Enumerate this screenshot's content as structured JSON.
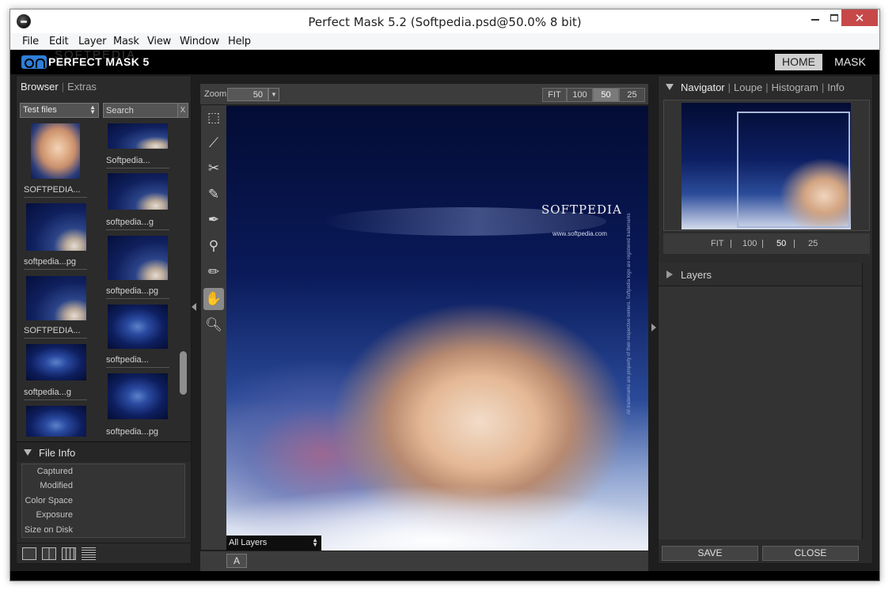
{
  "window": {
    "title": "Perfect Mask 5.2 (Softpedia.psd@50.0% 8 bit)"
  },
  "menu": {
    "items": [
      "File",
      "Edit",
      "Layer",
      "Mask",
      "View",
      "Window",
      "Help"
    ]
  },
  "brand": {
    "name": "PERFECT MASK 5",
    "watermark": "SOFTPEDIA",
    "home": "HOME",
    "mask": "MASK"
  },
  "left": {
    "tabs": {
      "browser": "Browser",
      "extras": "Extras"
    },
    "folder": "Test files",
    "search_placeholder": "Search",
    "search_clear": "X",
    "thumbnails": [
      {
        "caption": "SOFTPEDIA...",
        "style": "face"
      },
      {
        "caption": "Softpedia...",
        "style": "blue"
      },
      {
        "caption": "softpedia...g",
        "style": "blue"
      },
      {
        "caption": "softpedia...pg",
        "style": "blue"
      },
      {
        "caption": "softpedia...pg",
        "style": "blue"
      },
      {
        "caption": "SOFTPEDIA...",
        "style": "blue"
      },
      {
        "caption": "softpedia...",
        "style": "swirl"
      },
      {
        "caption": "softpedia...g",
        "style": "swirl"
      },
      {
        "caption": "softpedia...pg",
        "style": "swirl"
      },
      {
        "caption": "",
        "style": "swirl"
      }
    ],
    "file_info": {
      "title": "File Info",
      "rows": [
        "Captured",
        "Modified",
        "Color Space",
        "Exposure",
        "Size on Disk"
      ]
    }
  },
  "center": {
    "zoom_label": "Zoom",
    "zoom_value": "50",
    "zoom_buttons": [
      "FIT",
      "100",
      "50",
      "25"
    ],
    "zoom_active": "50",
    "layers_select": "All Layers",
    "a_button": "A",
    "canvas": {
      "logo_text": "SOFTPEDIA",
      "url_text": "www.softpedia.com",
      "side_text": "All trademarks are property of their respective owners. Softpedia logo are registered trademarks"
    }
  },
  "right": {
    "tabs": [
      "Navigator",
      "Loupe",
      "Histogram",
      "Info"
    ],
    "active_tab": "Navigator",
    "nav_zoom": [
      "FIT",
      "100",
      "50",
      "25"
    ],
    "nav_zoom_active": "50",
    "layers_title": "Layers",
    "save": "SAVE",
    "close": "CLOSE"
  },
  "icons": {
    "app": "app-icon",
    "minimize": "minimize-icon",
    "maximize": "maximize-icon",
    "close": "close-icon"
  }
}
